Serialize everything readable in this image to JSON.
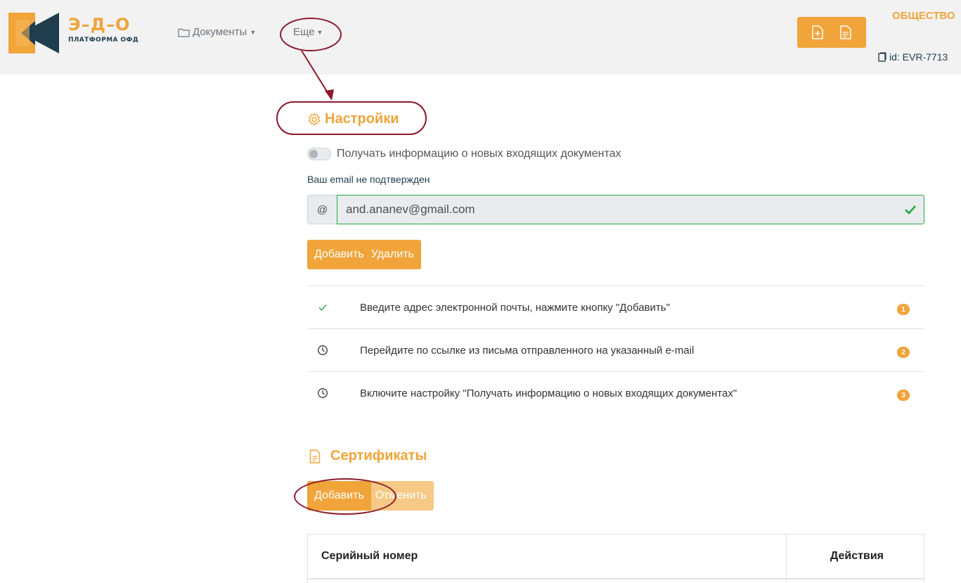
{
  "header": {
    "logo_title": "Э–Д–О",
    "logo_subtitle": "ПЛАТФОРМА ОФД",
    "nav": {
      "documents_label": "Документы",
      "more_label": "Еще"
    },
    "org_name": "ОБЩЕСТВО",
    "org_id": "id: EVR-7713"
  },
  "settings": {
    "title": "Настройки",
    "toggle_label": "Получать информацию о новых входящих документах",
    "toggle_on": false,
    "email_warning": "Ваш email не подтвержден",
    "email_addon": "@",
    "email_value": "and.ananev@gmail.com",
    "add_label": "Добавить",
    "delete_label": "Удалить",
    "steps": [
      {
        "text": "Введите адрес электронной почты, нажмите кнопку \"Добавить\"",
        "status": "done",
        "badge": "1"
      },
      {
        "text": "Перейдите по ссылке из письма отправленного на указанный e-mail",
        "status": "pending",
        "badge": "2"
      },
      {
        "text": "Включите настройку \"Получать информацию о новых входящих документах\"",
        "status": "pending",
        "badge": "3"
      }
    ]
  },
  "certificates": {
    "title": "Сертификаты",
    "add_label": "Добавить",
    "cancel_label": "Отменить",
    "columns": [
      "Серийный номер",
      "Действия"
    ]
  },
  "colors": {
    "accent": "#f0a43a",
    "dark": "#1f3d4c",
    "annotation": "#8b1a2b",
    "success": "#28a745"
  }
}
